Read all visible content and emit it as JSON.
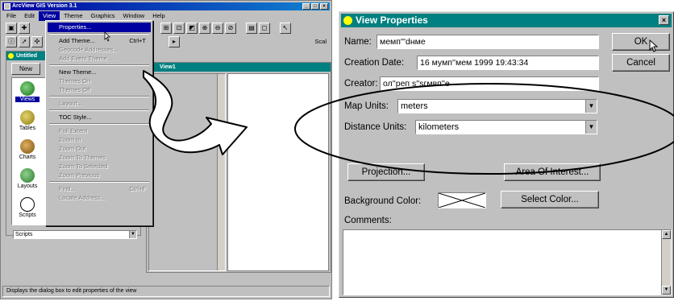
{
  "app": {
    "title": "ArcView GIS Version 3.1",
    "window_buttons": [
      "_",
      "□",
      "×"
    ],
    "menus": [
      "File",
      "Edit",
      "View",
      "Theme",
      "Graphics",
      "Window",
      "Help"
    ],
    "scale_label": "Scal",
    "status_text": "Displays the dialog box to edit properties of the view"
  },
  "view_menu": {
    "items": [
      {
        "label": "Properties...",
        "shortcut": "",
        "state": "highlighted"
      },
      {
        "sep": true
      },
      {
        "label": "Add Theme...",
        "shortcut": "Ctrl+T",
        "state": "enabled"
      },
      {
        "label": "Geocode Addresses...",
        "shortcut": "",
        "state": "disabled"
      },
      {
        "label": "Add Event Theme...",
        "shortcut": "",
        "state": "disabled"
      },
      {
        "sep": true
      },
      {
        "label": "New Theme...",
        "shortcut": "",
        "state": "enabled"
      },
      {
        "label": "Themes On",
        "shortcut": "",
        "state": "disabled"
      },
      {
        "label": "Themes Off",
        "shortcut": "",
        "state": "disabled"
      },
      {
        "sep": true
      },
      {
        "label": "Layout...",
        "shortcut": "",
        "state": "disabled"
      },
      {
        "sep": true
      },
      {
        "label": "TOC Style...",
        "shortcut": "",
        "state": "enabled"
      },
      {
        "sep": true
      },
      {
        "label": "Full Extent",
        "shortcut": "",
        "state": "disabled"
      },
      {
        "label": "Zoom In",
        "shortcut": "",
        "state": "disabled"
      },
      {
        "label": "Zoom Out",
        "shortcut": "",
        "state": "disabled"
      },
      {
        "label": "Zoom To Themes",
        "shortcut": "",
        "state": "disabled"
      },
      {
        "label": "Zoom To Selected",
        "shortcut": "",
        "state": "disabled"
      },
      {
        "label": "Zoom Previous",
        "shortcut": "",
        "state": "disabled"
      },
      {
        "sep": true
      },
      {
        "label": "Find...",
        "shortcut": "Ctrl+F",
        "state": "disabled"
      },
      {
        "label": "Locate Address...",
        "shortcut": "",
        "state": "disabled"
      }
    ]
  },
  "project": {
    "title": "Untitled",
    "new_label": "New",
    "docs": [
      {
        "label": "Views",
        "selected": true,
        "icon": "views-icon"
      },
      {
        "label": "Tables",
        "selected": false,
        "icon": "tables-icon"
      },
      {
        "label": "Charts",
        "selected": false,
        "icon": "charts-icon"
      },
      {
        "label": "Layouts",
        "selected": false,
        "icon": "layouts-icon"
      },
      {
        "label": "Scripts",
        "selected": false,
        "icon": "scripts-icon"
      }
    ],
    "scripts_select": "Scripts"
  },
  "view1": {
    "title": "View1"
  },
  "dialog": {
    "title": "View Properties",
    "close": "×",
    "name_label": "Name:",
    "name_value": "мемп'''dнме",
    "creation_label": "Creation Date:",
    "creation_value": "16 мумп''мем 1999 19:43:34",
    "creator_label": "Creator:",
    "creator_value": "ол''реп s''sгмвп''е",
    "map_units_label": "Map Units:",
    "map_units_value": "meters",
    "distance_units_label": "Distance Units:",
    "distance_units_value": "kilometers",
    "ok_label": "OK",
    "cancel_label": "Cancel",
    "projection_label": "Projection...",
    "area_label": "Area Of Interest...",
    "bg_color_label": "Background Color:",
    "select_color_label": "Select Color...",
    "comments_label": "Comments:"
  }
}
